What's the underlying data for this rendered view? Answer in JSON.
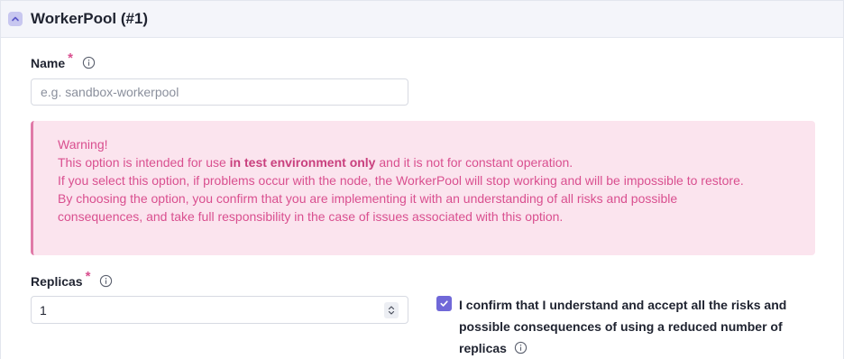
{
  "panel": {
    "title": "WorkerPool (#1)"
  },
  "name_field": {
    "label": "Name",
    "required_mark": "*",
    "value": "",
    "placeholder": "e.g. sandbox-workerpool"
  },
  "warning": {
    "heading": "Warning!",
    "line1_prefix": "This option is intended for use ",
    "line1_bold": "in test environment only",
    "line1_suffix": " and it is not for constant operation.",
    "line2": "If you select this option, if problems occur with the node, the WorkerPool will stop working and will be impossible to restore.",
    "line3": "By choosing the option, you confirm that you are implementing it with an understanding of all risks and possible consequences, and take full responsibility in the case of issues associated with this option."
  },
  "replicas_field": {
    "label": "Replicas",
    "required_mark": "*",
    "value": "1"
  },
  "confirm_checkbox": {
    "checked": true,
    "label": "I confirm that I understand and accept all the risks and possible consequences of using a reduced number of replicas"
  },
  "colors": {
    "accent": "#7068d8",
    "warning_text": "#d94f8f",
    "warning_bg": "#fbe4ee"
  },
  "icons": [
    "chevron-up-icon",
    "info-icon",
    "checkmark-icon",
    "spinner-up-icon",
    "spinner-down-icon"
  ]
}
